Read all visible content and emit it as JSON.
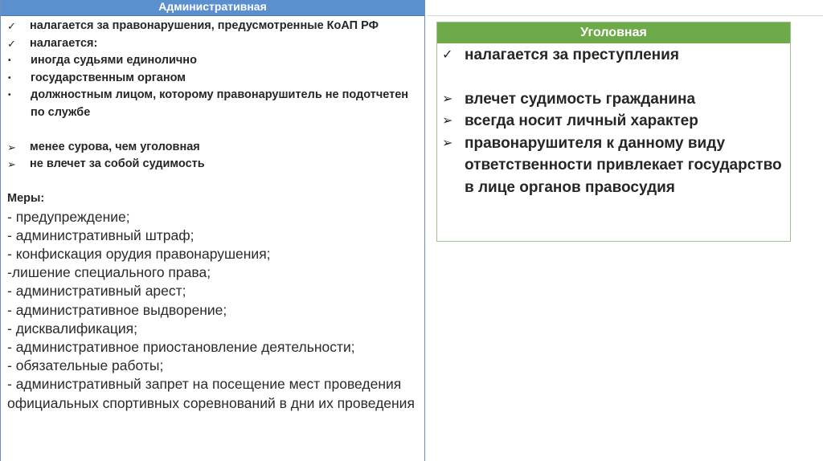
{
  "left": {
    "header": "Административная",
    "bullets": [
      {
        "marker": "✓",
        "type": "check",
        "text": "налагается за правонарушения, предусмотренные КоАП РФ"
      },
      {
        "marker": "✓",
        "type": "check",
        "text": "налагается:"
      },
      {
        "marker": "•",
        "type": "dot",
        "text": "иногда судьями единолично"
      },
      {
        "marker": "•",
        "type": "dot",
        "text": "государственным органом"
      },
      {
        "marker": "•",
        "type": "dot",
        "text": "должностным лицом, которому правонарушитель не подотчетен по службе"
      }
    ],
    "arrows": [
      {
        "marker": "➢",
        "text": "менее сурова, чем уголовная"
      },
      {
        "marker": "➢",
        "text": "не влечет за собой судимость"
      }
    ],
    "measures_title": "Меры:",
    "measures": [
      "-  предупреждение;",
      "- административный штраф;",
      "- конфискация орудия правонарушения;",
      "-лишение специального права;",
      "- административный арест;",
      "- административное выдворение;",
      "- дисквалификация;",
      "- административное приостановление деятельности;",
      "- обязательные работы;",
      "- административный запрет на посещение мест проведения официальных спортивных соревнований в дни их проведения"
    ]
  },
  "right": {
    "header": "Уголовная",
    "check_item": {
      "marker": "✓",
      "text": "налагается за преступления"
    },
    "arrows": [
      {
        "marker": "➢",
        "text": "влечет судимость гражданина"
      },
      {
        "marker": "➢",
        "text": "всегда носит личный характер"
      },
      {
        "marker": "➢",
        "text": "правонарушителя к данному виду ответственности привлекает государство в лице органов правосудия"
      }
    ]
  },
  "colors": {
    "left_header_bg": "#5b8fcd",
    "right_header_bg": "#6ea94a",
    "text": "#262626"
  }
}
